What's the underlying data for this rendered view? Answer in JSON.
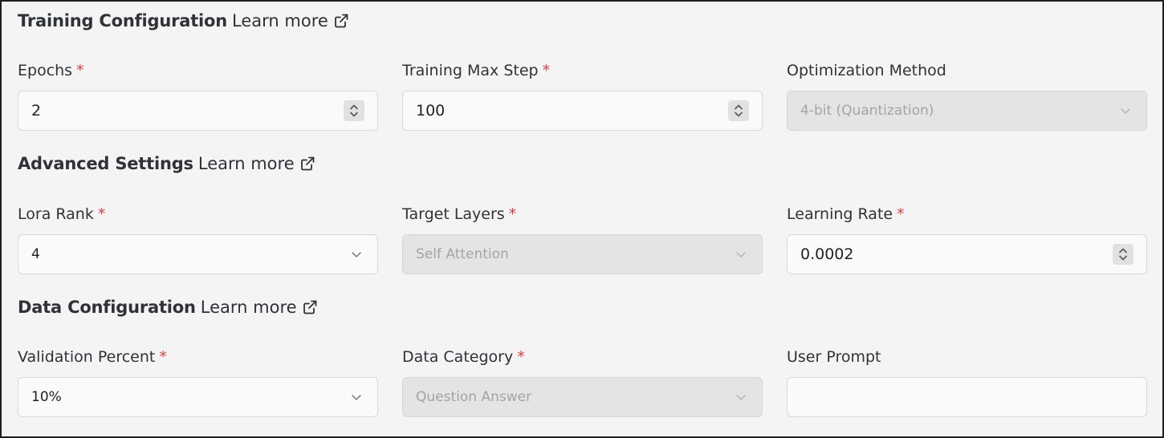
{
  "sections": {
    "training": {
      "title": "Training Configuration",
      "learn_more": "Learn more"
    },
    "advanced": {
      "title": "Advanced Settings",
      "learn_more": "Learn more"
    },
    "data": {
      "title": "Data Configuration",
      "learn_more": "Learn more"
    }
  },
  "fields": {
    "epochs": {
      "label": "Epochs",
      "value": "2",
      "required": "*"
    },
    "max_step": {
      "label": "Training Max Step",
      "value": "100",
      "required": "*"
    },
    "optimization": {
      "label": "Optimization Method",
      "value": "4-bit (Quantization)"
    },
    "lora_rank": {
      "label": "Lora Rank",
      "value": "4",
      "required": "*"
    },
    "target_layers": {
      "label": "Target Layers",
      "value": "Self Attention",
      "required": "*"
    },
    "learning_rate": {
      "label": "Learning Rate",
      "value": "0.0002",
      "required": "*"
    },
    "validation_percent": {
      "label": "Validation Percent",
      "value": "10%",
      "required": "*"
    },
    "data_category": {
      "label": "Data Category",
      "value": "Question Answer",
      "required": "*"
    },
    "user_prompt": {
      "label": "User Prompt",
      "value": ""
    }
  },
  "icons": {
    "external_link": "external-link-icon",
    "stepper": "up-down-stepper-icon",
    "chevron": "chevron-down-icon"
  },
  "colors": {
    "background": "#f4f4f4",
    "required": "#e03e3e",
    "disabled_field": "#e4e4e4",
    "text": "#2f3338"
  }
}
